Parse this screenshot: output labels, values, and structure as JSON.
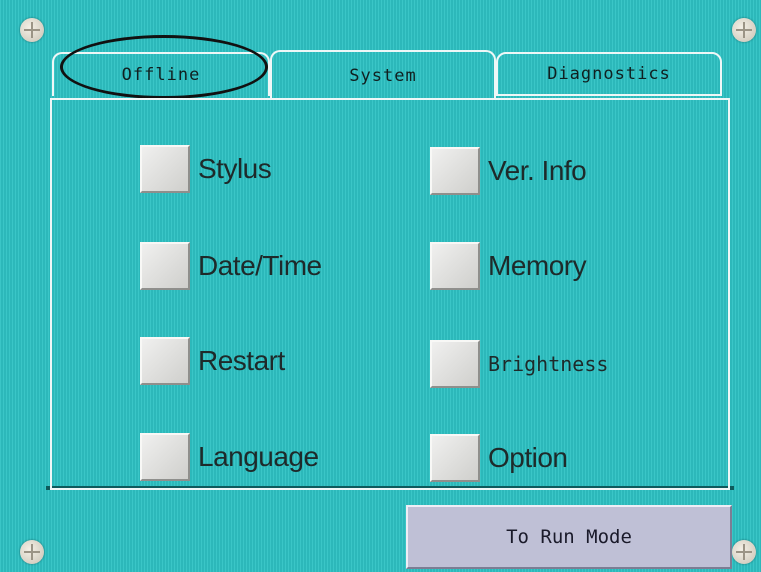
{
  "tabs": [
    {
      "label": "Offline",
      "highlighted": true
    },
    {
      "label": "System",
      "active": true
    },
    {
      "label": "Diagnostics"
    }
  ],
  "buttons": {
    "stylus": "Stylus",
    "date_time": "Date/Time",
    "restart": "Restart",
    "language": "Language",
    "ver_info": "Ver. Info",
    "memory": "Memory",
    "brightness": "Brightness",
    "option": "Option"
  },
  "run_mode_button": "To Run Mode",
  "colors": {
    "background": "#2ec2c4",
    "button_face": "#d8d8d6",
    "run_button_face": "#bfc0d6"
  }
}
